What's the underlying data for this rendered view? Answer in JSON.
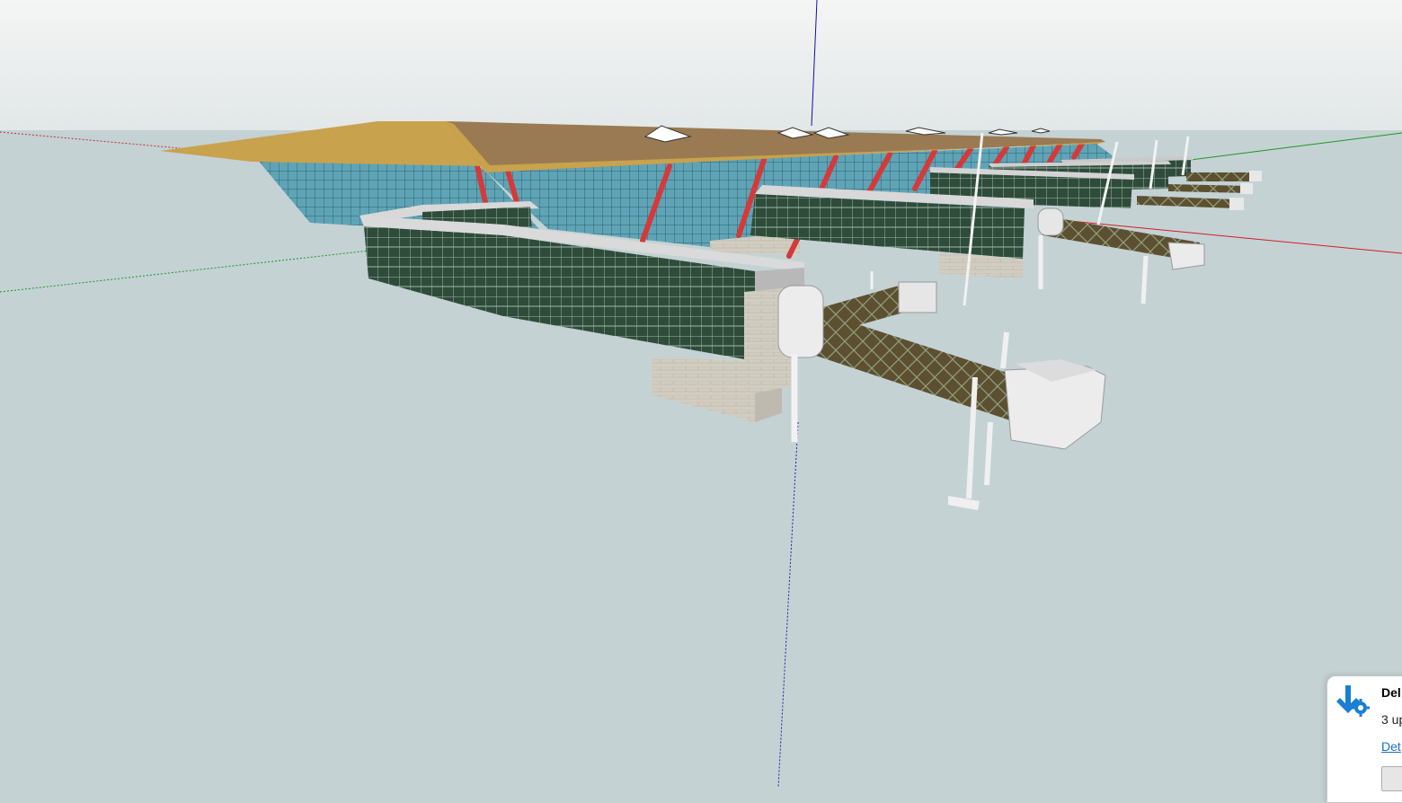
{
  "viewport": {
    "sky_color": "#ecefef",
    "ground_color": "#c4d2d4",
    "axis_colors": {
      "red": "#d02020",
      "green": "#1a9a1a",
      "blue": "#1010a0"
    }
  },
  "model": {
    "roof_color": "#9a7a52",
    "roof_edge_color": "#c8a24c",
    "glass_color": "#5fa4b6",
    "column_color": "#d43a3a",
    "corridor_glass_color": "#2d4a3a",
    "jet_bridge_color": "#6a5a3c",
    "concrete_color": "#d0cbbf"
  },
  "notification": {
    "icon": "windows-update-gear-icon",
    "title": "Del",
    "message": "3 up",
    "link_label": "Det"
  }
}
